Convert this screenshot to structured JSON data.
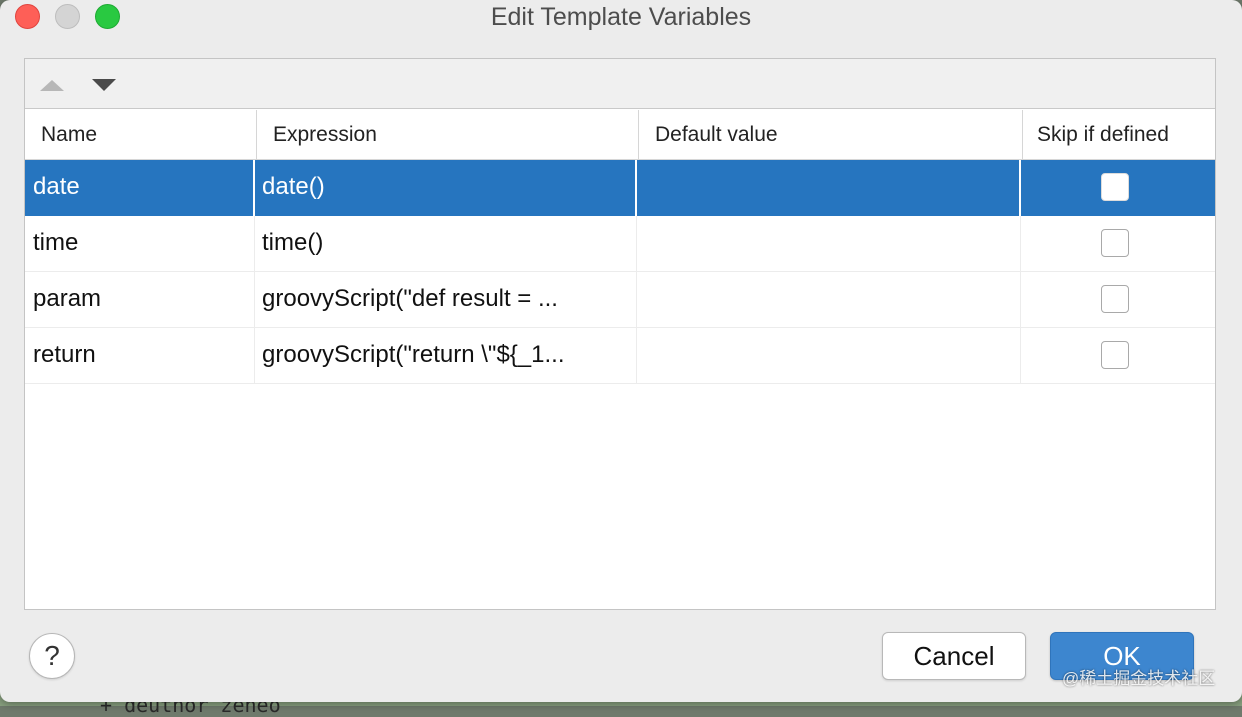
{
  "window": {
    "title": "Edit Template Variables"
  },
  "toolbar": {
    "move_up_icon": "triangle-up",
    "move_down_icon": "triangle-down"
  },
  "table": {
    "columns": [
      "Name",
      "Expression",
      "Default value",
      "Skip if defined"
    ],
    "rows": [
      {
        "name": "date",
        "expression": "date()",
        "default_value": "",
        "skip_if_defined": false,
        "selected": true
      },
      {
        "name": "time",
        "expression": "time()",
        "default_value": "",
        "skip_if_defined": false,
        "selected": false
      },
      {
        "name": "param",
        "expression": "groovyScript(\"def result = ...",
        "default_value": "",
        "skip_if_defined": false,
        "selected": false
      },
      {
        "name": "return",
        "expression": "groovyScript(\"return \\\"${_1...",
        "default_value": "",
        "skip_if_defined": false,
        "selected": false
      }
    ]
  },
  "footer": {
    "help_label": "?",
    "cancel_label": "Cancel",
    "ok_label": "OK"
  },
  "background": {
    "code_fragment": "+ deuthor zeneo"
  },
  "watermark": "@稀土掘金技术社区",
  "colors": {
    "selection": "#2675bf",
    "ok_button": "#3d86cf",
    "close_button": "#fe5f57",
    "maximize_button": "#29c941"
  }
}
